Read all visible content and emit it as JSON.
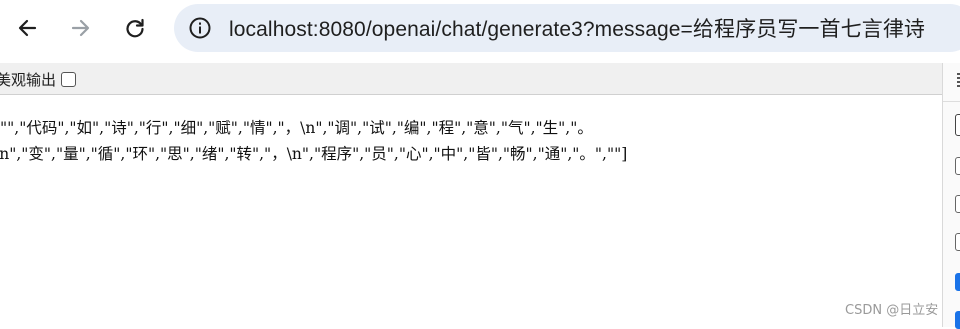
{
  "browser": {
    "url": "localhost:8080/openai/chat/generate3?message=给程序员写一首七言律诗",
    "back_icon": "arrow-left-icon",
    "forward_icon": "arrow-right-icon",
    "reload_icon": "reload-icon",
    "site_info_icon": "info-icon"
  },
  "pretty_print": {
    "label": "美观输出",
    "checked": false
  },
  "json_output": {
    "line1": "[\"\",\"代码\",\"如\",\"诗\",\"行\",\"细\",\"赋\",\"情\",\"，\\n\",\"调\",\"试\",\"编\",\"程\",\"意\",\"气\",\"生\",\"。",
    "line2": "\\n\",\"变\",\"量\",\"循\",\"环\",\"思\",\"绪\",\"转\",\"，\\n\",\"程序\",\"员\",\"心\",\"中\",\"皆\",\"畅\",\"通\",\"。\",\"\"]"
  },
  "watermark": "CSDN @日立安"
}
